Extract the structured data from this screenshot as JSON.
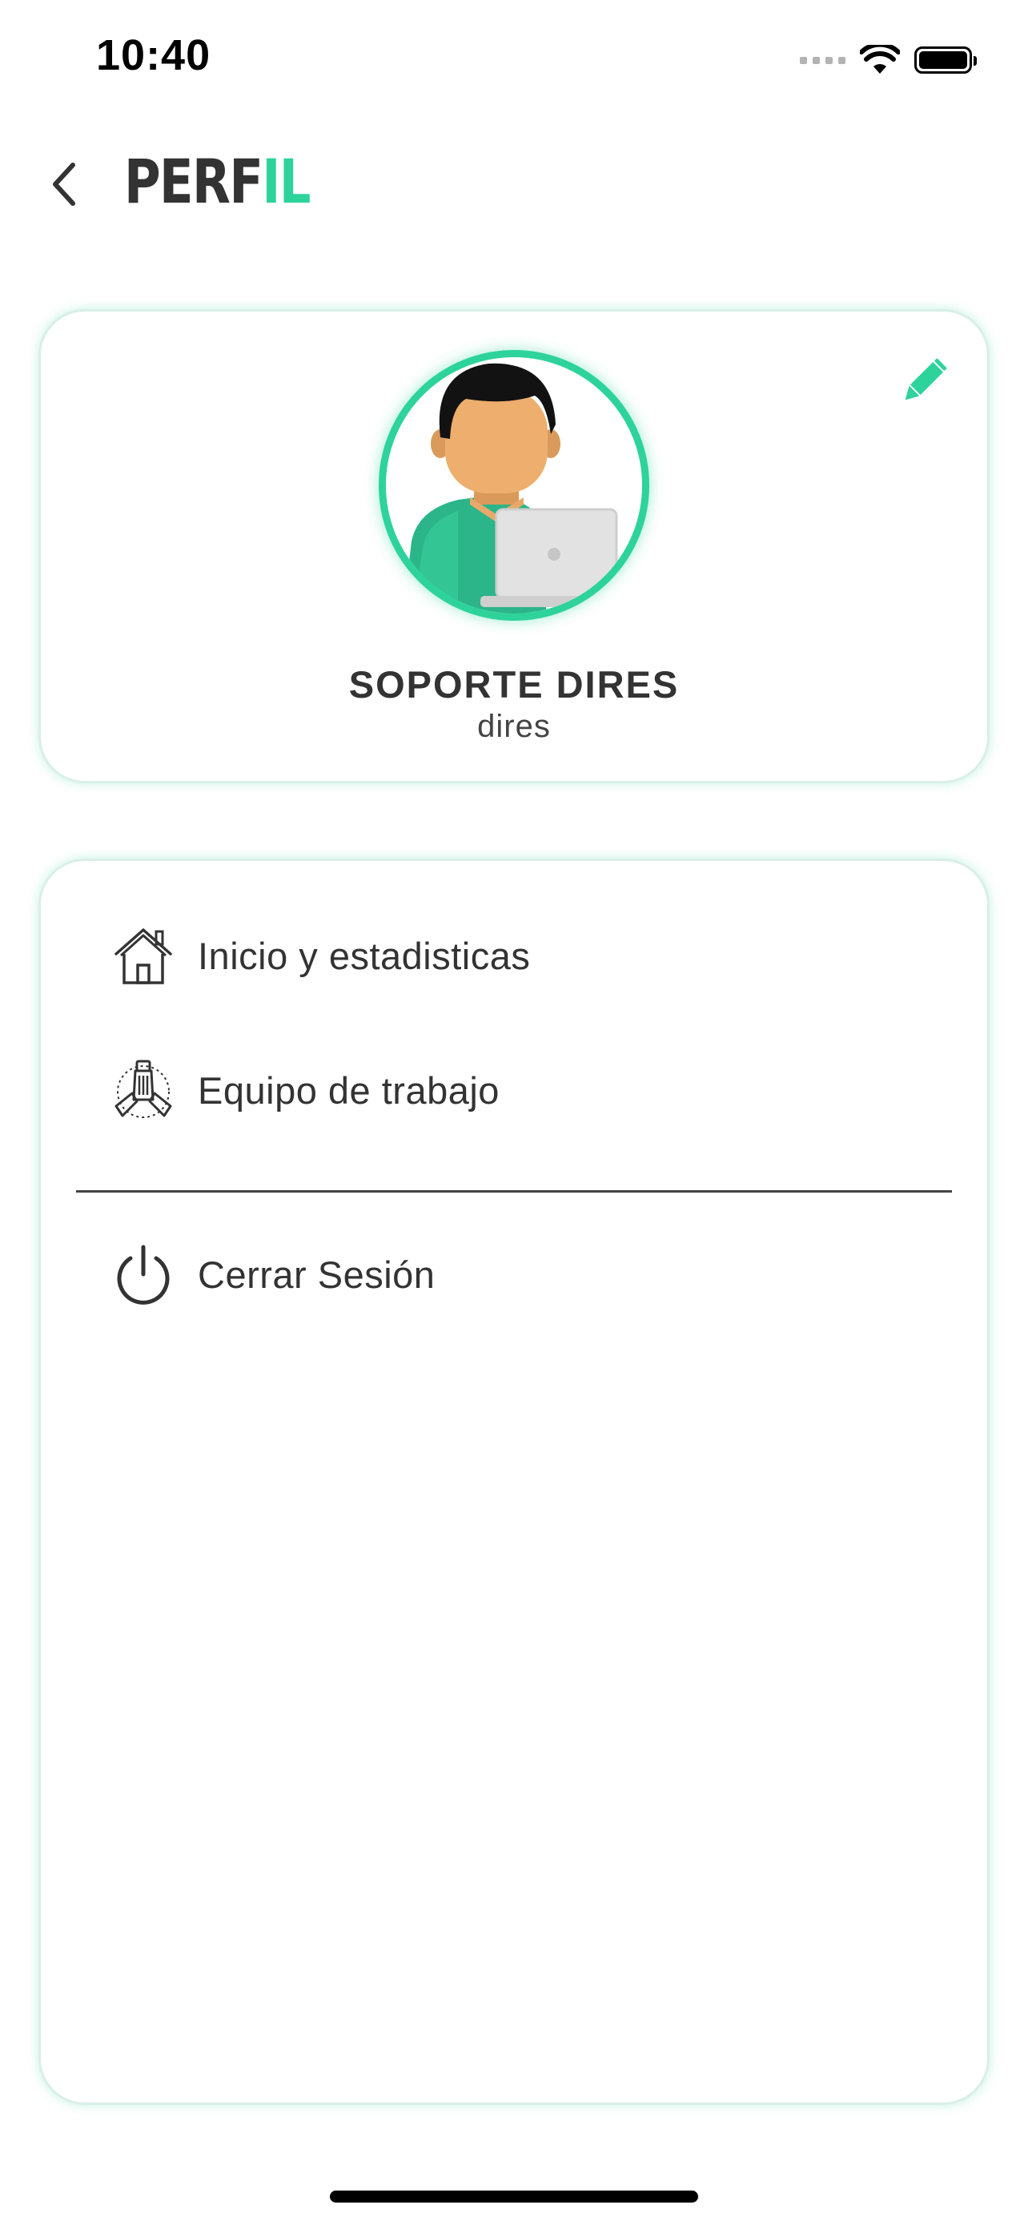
{
  "status_bar": {
    "time": "10:40",
    "icons": [
      "cellular-signal-icon",
      "wifi-icon",
      "battery-icon"
    ]
  },
  "header": {
    "back_icon": "chevron-left-icon",
    "title_dark": "PERF",
    "title_accent": "IL"
  },
  "profile": {
    "name": "SOPORTE DIRES",
    "username": "dires",
    "edit_icon": "pencil-icon",
    "avatar": "user-avatar-illustration"
  },
  "menu": {
    "items": [
      {
        "label": "Inicio y estadisticas",
        "icon": "home-icon"
      },
      {
        "label": "Equipo de trabajo",
        "icon": "team-hands-icon"
      }
    ],
    "logout": {
      "label": "Cerrar Sesión",
      "icon": "power-icon"
    }
  },
  "colors": {
    "accent": "#2dd39b",
    "text": "#333333",
    "background": "#ffffff"
  }
}
